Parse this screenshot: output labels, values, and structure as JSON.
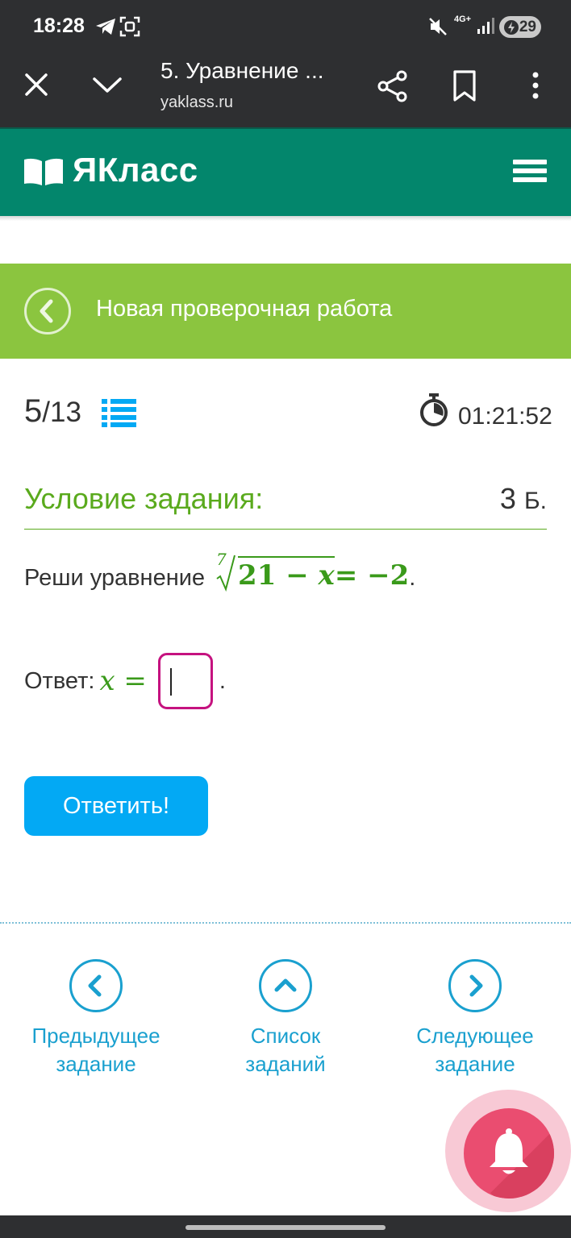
{
  "status_bar": {
    "time": "18:28",
    "network": "4G+",
    "battery": "29"
  },
  "browser": {
    "title": "5. Уравнение ...",
    "url": "yaklass.ru"
  },
  "site": {
    "logo_text": "ЯКласс"
  },
  "banner": {
    "title": "Новая проверочная работа"
  },
  "progress": {
    "current": "5",
    "total": "13",
    "timer": "01:21:52"
  },
  "condition": {
    "heading": "Условие задания:",
    "points_value": "3",
    "points_unit": "Б.",
    "task_prefix": "Реши уравнение",
    "root_index": "7",
    "radicand_number": "21 − ",
    "radicand_var": "x",
    "equation_rhs": " = −2",
    "task_suffix": "."
  },
  "answer": {
    "label": "Ответ:",
    "variable": "x",
    "equals": " =",
    "value": "",
    "suffix": "."
  },
  "submit_label": "Ответить!",
  "nav": {
    "prev": {
      "line1": "Предыдущее",
      "line2": "задание"
    },
    "list": {
      "line1": "Список",
      "line2": "заданий"
    },
    "next": {
      "line1": "Следующее",
      "line2": "задание"
    }
  },
  "colors": {
    "header_teal": "#03866c",
    "banner_green": "#8bc53f",
    "condition_green": "#5aaa1d",
    "accent_blue": "#03a9f4",
    "nav_blue": "#1aa0cf",
    "input_border": "#c5127f",
    "bell_pink": "#ea4d70"
  },
  "icons": {
    "close": "close-icon",
    "collapse": "chevron-down-icon",
    "share": "share-icon",
    "bookmark": "bookmark-icon",
    "more": "more-vertical-icon",
    "logo": "open-book-icon",
    "menu": "hamburger-menu-icon",
    "back": "chevron-left-icon",
    "task_list": "list-icon",
    "timer": "stopwatch-icon",
    "prev": "chevron-left-icon",
    "list": "chevron-up-icon",
    "next": "chevron-right-icon",
    "notification": "bell-icon"
  }
}
